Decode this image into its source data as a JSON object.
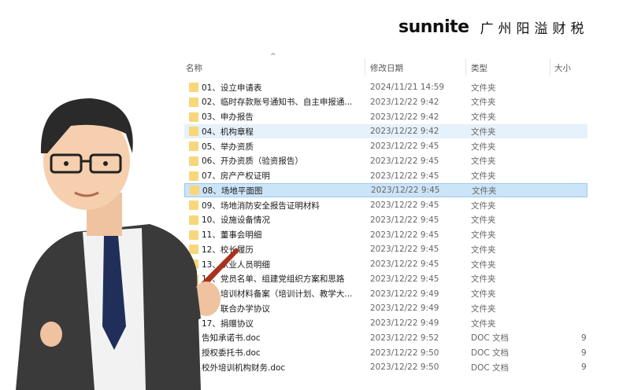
{
  "brand": {
    "en": "sunnite",
    "cn": "广州阳溢财税"
  },
  "columns": {
    "name": "名称",
    "date": "修改日期",
    "type": "类型",
    "size": "大小"
  },
  "files": [
    {
      "name": "01、设立申请表",
      "date": "2024/11/21 14:59",
      "type": "文件夹",
      "size": "",
      "icon": "folder"
    },
    {
      "name": "02、临时存款账号通知书、自主申报通...",
      "date": "2023/12/22 9:42",
      "type": "文件夹",
      "size": "",
      "icon": "folder"
    },
    {
      "name": "03、申办报告",
      "date": "2023/12/22 9:42",
      "type": "文件夹",
      "size": "",
      "icon": "folder"
    },
    {
      "name": "04、机构章程",
      "date": "2023/12/22 9:42",
      "type": "文件夹",
      "size": "",
      "icon": "folder",
      "state": "hover"
    },
    {
      "name": "05、举办资质",
      "date": "2023/12/22 9:45",
      "type": "文件夹",
      "size": "",
      "icon": "folder"
    },
    {
      "name": "06、开办资质（验资报告）",
      "date": "2023/12/22 9:45",
      "type": "文件夹",
      "size": "",
      "icon": "folder"
    },
    {
      "name": "07、房产产权证明",
      "date": "2023/12/22 9:45",
      "type": "文件夹",
      "size": "",
      "icon": "folder"
    },
    {
      "name": "08、场地平面图",
      "date": "2023/12/22 9:45",
      "type": "文件夹",
      "size": "",
      "icon": "folder",
      "state": "selected"
    },
    {
      "name": "09、场地消防安全报告证明材料",
      "date": "2023/12/22 9:45",
      "type": "文件夹",
      "size": "",
      "icon": "folder"
    },
    {
      "name": "10、设施设备情况",
      "date": "2023/12/22 9:45",
      "type": "文件夹",
      "size": "",
      "icon": "folder"
    },
    {
      "name": "11、董事会明细",
      "date": "2023/12/22 9:45",
      "type": "文件夹",
      "size": "",
      "icon": "folder"
    },
    {
      "name": "12、校长履历",
      "date": "2023/12/22 9:45",
      "type": "文件夹",
      "size": "",
      "icon": "folder"
    },
    {
      "name": "13、从业人员明细",
      "date": "2023/12/22 9:45",
      "type": "文件夹",
      "size": "",
      "icon": "folder"
    },
    {
      "name": "14、党员名单、组建党组织方案和思路",
      "date": "2023/12/22 9:45",
      "type": "文件夹",
      "size": "",
      "icon": "folder"
    },
    {
      "name": "15、培训材料备案（培训计划、教学大...",
      "date": "2023/12/22 9:49",
      "type": "文件夹",
      "size": "",
      "icon": "folder"
    },
    {
      "name": "16、联合办学协议",
      "date": "2023/12/22 9:49",
      "type": "文件夹",
      "size": "",
      "icon": "folder"
    },
    {
      "name": "17、捐赠协议",
      "date": "2023/12/22 9:49",
      "type": "文件夹",
      "size": "",
      "icon": "folder"
    },
    {
      "name": "告知承诺书.doc",
      "date": "2023/12/22 9:52",
      "type": "DOC 文档",
      "size": "9",
      "icon": "doc"
    },
    {
      "name": "授权委托书.doc",
      "date": "2023/12/22 9:50",
      "type": "DOC 文档",
      "size": "9",
      "icon": "doc"
    },
    {
      "name": "校外培训机构财务.doc",
      "date": "2023/12/22 9:50",
      "type": "DOC 文档",
      "size": "9",
      "icon": "doc"
    }
  ]
}
